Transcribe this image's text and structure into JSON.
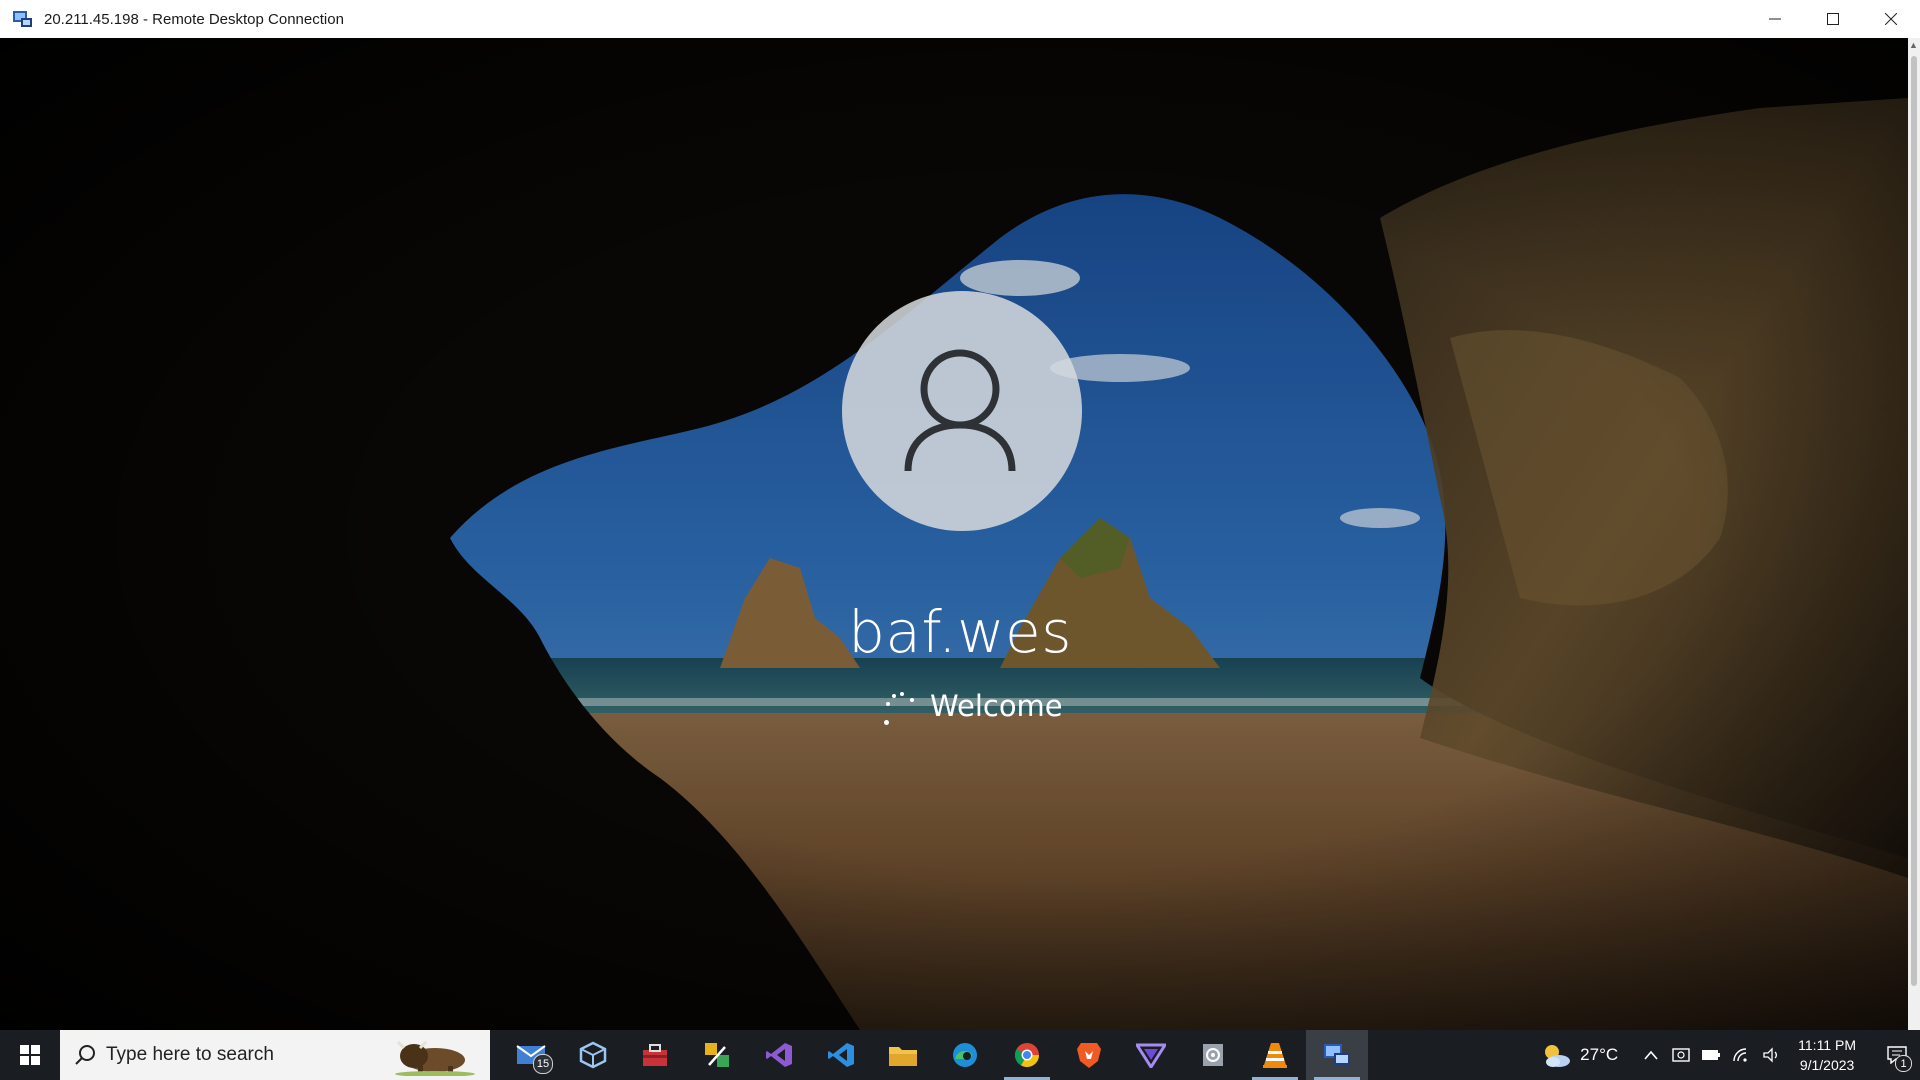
{
  "window": {
    "title": "20.211.45.198 - Remote Desktop Connection",
    "controls": [
      "minimize",
      "maximize",
      "close"
    ]
  },
  "login": {
    "username": "baf.wes",
    "status": "Welcome",
    "avatar_icon": "user-silhouette-icon"
  },
  "taskbar": {
    "search_placeholder": "Type here to search",
    "apps": [
      {
        "name": "mail",
        "badge": "15"
      },
      {
        "name": "virtualbox"
      },
      {
        "name": "toolbox"
      },
      {
        "name": "snipping-tool"
      },
      {
        "name": "visual-studio"
      },
      {
        "name": "vscode"
      },
      {
        "name": "file-explorer"
      },
      {
        "name": "edge"
      },
      {
        "name": "chrome",
        "running": true
      },
      {
        "name": "brave"
      },
      {
        "name": "protonvpn"
      },
      {
        "name": "settings-app"
      },
      {
        "name": "vlc",
        "running": true
      },
      {
        "name": "remote-desktop",
        "running": true,
        "active": true
      }
    ],
    "weather": {
      "temp": "27°C",
      "icon": "partly-cloudy-icon"
    },
    "clock": {
      "time": "11:11 PM",
      "date": "9/1/2023"
    },
    "notifications": "1"
  }
}
